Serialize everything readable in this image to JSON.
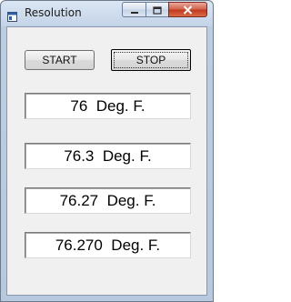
{
  "window": {
    "title": "Resolution"
  },
  "buttons": {
    "start_label": "START",
    "stop_label": "STOP"
  },
  "readouts": [
    "76  Deg. F.",
    "76.3  Deg. F.",
    "76.27  Deg. F.",
    "76.270  Deg. F."
  ],
  "icons": {
    "app": "app-window-icon",
    "minimize": "minimize-icon",
    "maximize": "maximize-icon",
    "close": "close-icon"
  },
  "colors": {
    "titlebar": "#c3d3e7",
    "client_bg": "#f0f0f0",
    "close_button": "#c13a1f"
  }
}
